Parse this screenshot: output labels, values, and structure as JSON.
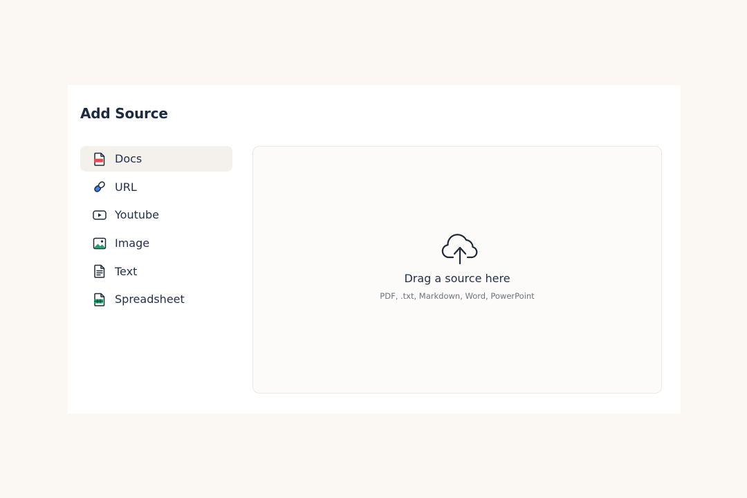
{
  "dialog": {
    "title": "Add Source"
  },
  "sources": [
    {
      "label": "Docs",
      "icon": "pdf-file-icon",
      "active": true
    },
    {
      "label": "URL",
      "icon": "link-icon",
      "active": false
    },
    {
      "label": "Youtube",
      "icon": "youtube-play-icon",
      "active": false
    },
    {
      "label": "Image",
      "icon": "image-icon",
      "active": false
    },
    {
      "label": "Text",
      "icon": "text-document-icon",
      "active": false
    },
    {
      "label": "Spreadsheet",
      "icon": "spreadsheet-icon",
      "active": false
    }
  ],
  "dropzone": {
    "icon": "cloud-upload-icon",
    "title": "Drag a source here",
    "subtitle": "PDF, .txt, Markdown, Word, PowerPoint"
  },
  "colors": {
    "page_background": "#fbf8f4",
    "card_background": "#ffffff",
    "active_item_background": "#f4f1ec",
    "text_primary": "#23304a",
    "text_muted": "#6b7280",
    "pdf_red": "#e5484d",
    "link_blue": "#3b82f6",
    "sheet_green": "#22a06b"
  }
}
